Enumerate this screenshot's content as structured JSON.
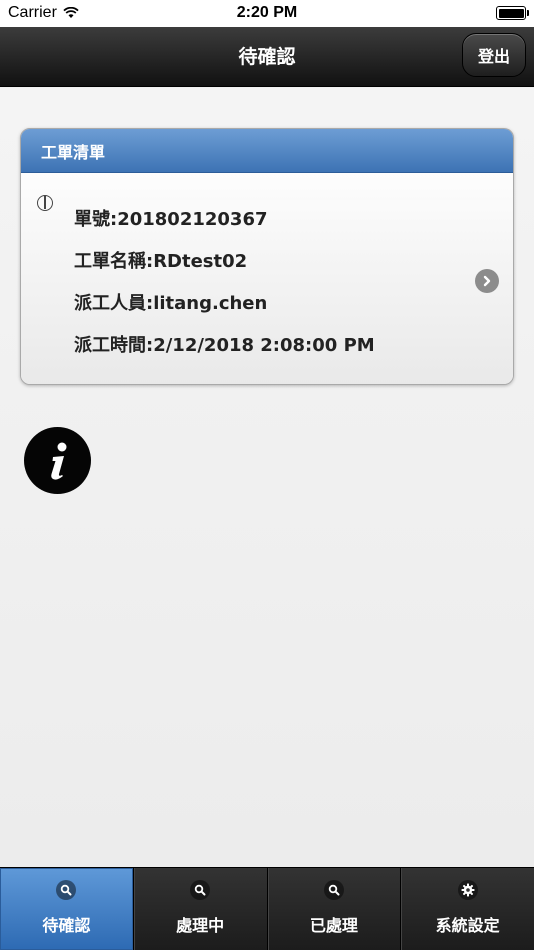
{
  "status_bar": {
    "carrier": "Carrier",
    "time": "2:20 PM"
  },
  "header": {
    "title": "待確認",
    "logout_label": "登出"
  },
  "work_order_list": {
    "title": "工單清單",
    "items": [
      {
        "order_no": "單號:201802120367",
        "order_name": "工單名稱:RDtest02",
        "dispatcher": "派工人員:litang.chen",
        "dispatch_time": "派工時間:2/12/2018 2:08:00 PM"
      }
    ]
  },
  "tabs": [
    {
      "label": "待確認",
      "icon": "search-icon",
      "active": true
    },
    {
      "label": "處理中",
      "icon": "search-icon",
      "active": false
    },
    {
      "label": "已處理",
      "icon": "search-icon",
      "active": false
    },
    {
      "label": "系統設定",
      "icon": "gear-icon",
      "active": false
    }
  ],
  "colors": {
    "accent": "#3d73b4",
    "header_dark": "#111111"
  }
}
